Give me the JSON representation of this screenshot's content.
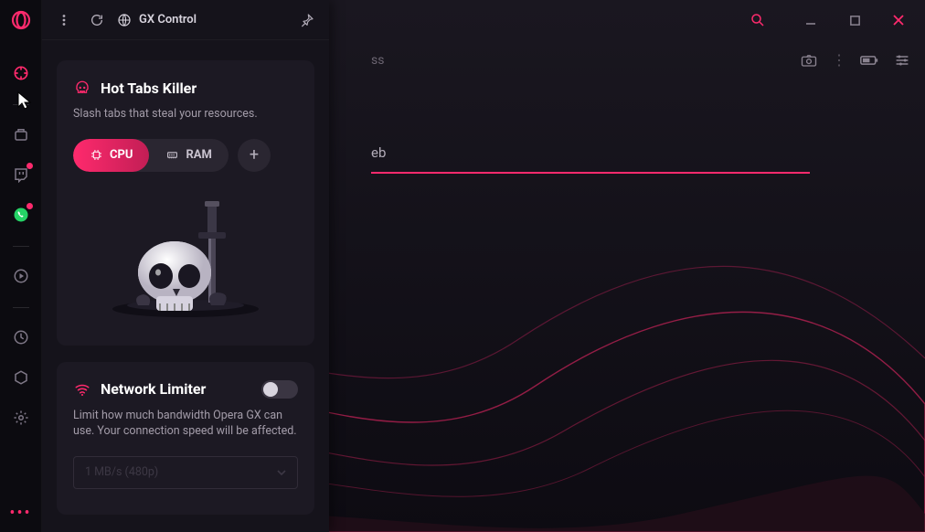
{
  "colors": {
    "accent": "#ff2a6d",
    "panel": "#15131b",
    "card": "#1c1923"
  },
  "panel": {
    "title": "GX Control"
  },
  "main": {
    "hint_ss": "ss",
    "hint_eb": "eb"
  },
  "hot_tabs": {
    "title": "Hot Tabs Killer",
    "subtitle": "Slash tabs that steal your resources.",
    "segments": {
      "cpu": "CPU",
      "ram": "RAM"
    }
  },
  "network": {
    "title": "Network Limiter",
    "subtitle": "Limit how much bandwidth Opera GX can use. Your connection speed will be affected.",
    "toggle_on": false,
    "select_value": "1 MB/s (480p)"
  }
}
